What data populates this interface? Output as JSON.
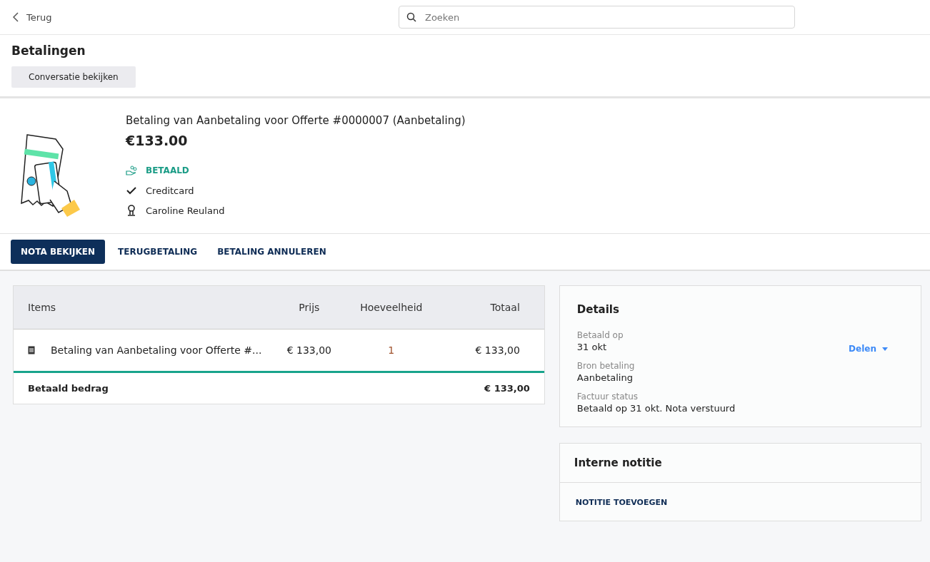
{
  "topbar": {
    "back": "Terug",
    "search": {
      "placeholder": "Zoeken"
    }
  },
  "page": {
    "title": "Betalingen",
    "button": "Conversatie bekijken"
  },
  "payment": {
    "title": "Betaling van Aanbetaling voor Offerte #0000007 (Aanbetaling)",
    "amount": "€133.00",
    "facts": [
      {
        "kind": "status",
        "text": "BETAALD"
      },
      {
        "kind": "method",
        "text": "Creditcard"
      },
      {
        "kind": "person",
        "text": "Caroline Reuland"
      }
    ]
  },
  "actions": [
    {
      "label": "NOTA BEKIJKEN",
      "kind": "primary"
    },
    {
      "label": "TERUGBETALING",
      "kind": "text"
    },
    {
      "label": "BETALING ANNULEREN",
      "kind": "text"
    }
  ],
  "table": {
    "columns": [
      "Items",
      "Prijs",
      "Hoeveelheid",
      "Totaal"
    ],
    "rows": [
      {
        "item": "Betaling van Aanbetaling voor Offerte #...",
        "price": "€ 133,00",
        "quantity": "1",
        "total": "€ 133,00"
      }
    ],
    "footer": {
      "label": "Betaald bedrag",
      "total": "€ 133,00"
    }
  },
  "details": {
    "title": "Details",
    "share": "Delen",
    "fields": [
      {
        "label": "Betaald op",
        "value": "31 okt"
      },
      {
        "label": "Bron betaling",
        "value": "Aanbetaling"
      },
      {
        "label": "Factuur status",
        "value": "Betaald op 31 okt. Nota verstuurd"
      }
    ]
  },
  "note": {
    "title": "Interne notitie",
    "action": "NOTITIE TOEVOEGEN"
  }
}
